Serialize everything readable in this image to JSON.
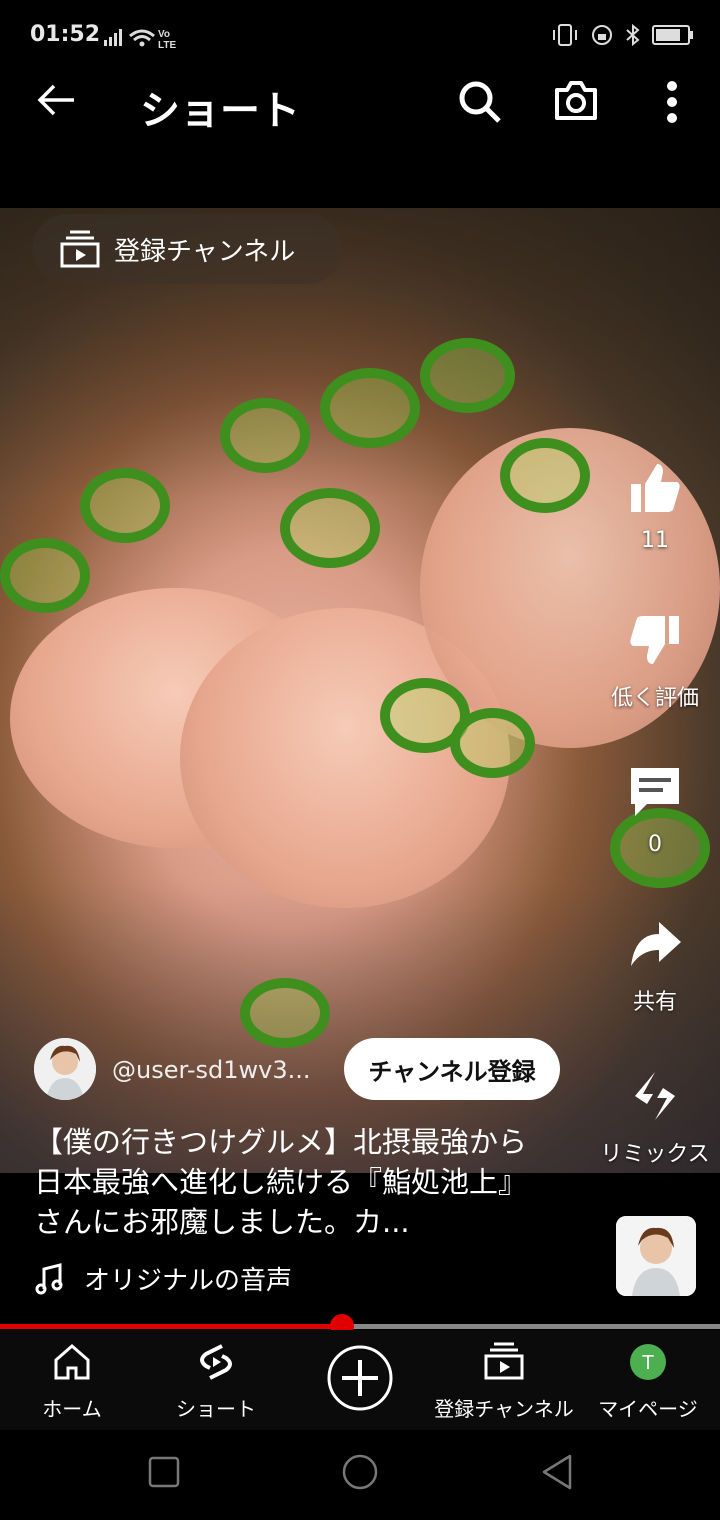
{
  "status_bar": {
    "time": "01:52",
    "network": "Vo LTE"
  },
  "header": {
    "title": "ショート"
  },
  "video": {
    "channel_chip": "登録チャンネル",
    "likes": "11",
    "dislike_label": "低く評価",
    "comments": "0",
    "share_label": "共有",
    "remix_label": "リミックス",
    "channel_handle": "@user-sd1wv3...",
    "subscribe_label": "チャンネル登録",
    "description": "【僕の行きつけグルメ】北摂最強から日本最強へ進化し続ける『鮨処池上』さんにお邪魔しました。カ...",
    "audio": "オリジナルの音声",
    "progress_percent": 47.5
  },
  "bottom_nav": {
    "home": "ホーム",
    "shorts": "ショート",
    "subscriptions": "登録チャンネル",
    "my_page": "マイページ",
    "avatar_letter": "T"
  },
  "colors": {
    "progress": "#e00000",
    "avatar_green": "#4caf50"
  }
}
